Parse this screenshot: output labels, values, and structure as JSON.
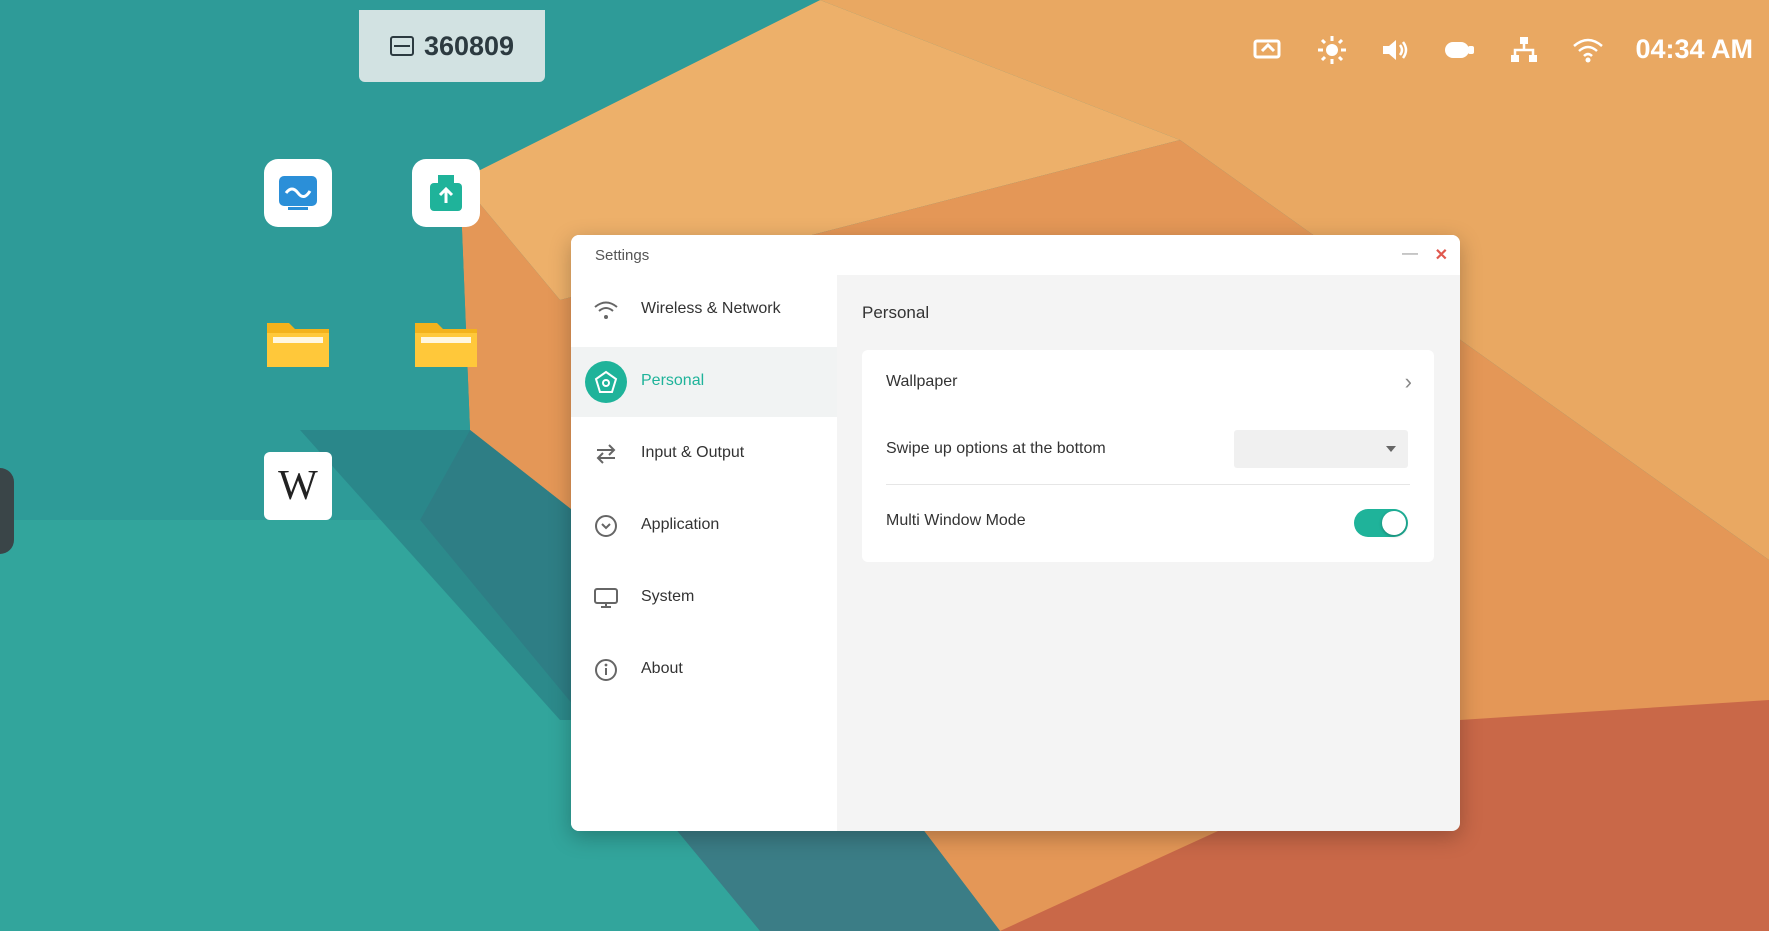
{
  "topbar": {
    "device_id": "360809",
    "device_icon": "monitor-icon",
    "time": "04:34 AM"
  },
  "status_icons": [
    "screen-share-icon",
    "brightness-icon",
    "volume-icon",
    "camera-icon",
    "network-icon",
    "wifi-icon"
  ],
  "desktop": {
    "icons": []
  },
  "window": {
    "title": "Settings",
    "sidebar": [
      {
        "title": "Wireless & Network",
        "subtitle": "",
        "icon": "wifi-icon",
        "active": false
      },
      {
        "title": "Personal",
        "subtitle": "",
        "icon": "personal-icon",
        "active": true
      },
      {
        "title": "Input & Output",
        "subtitle": "",
        "icon": "swap-icon",
        "active": false
      },
      {
        "title": "Application",
        "subtitle": "",
        "icon": "app-icon",
        "active": false
      },
      {
        "title": "System",
        "subtitle": "",
        "icon": "monitor-icon",
        "active": false
      },
      {
        "title": "About",
        "subtitle": "",
        "icon": "info-icon",
        "active": false
      }
    ],
    "content": {
      "title": "Personal",
      "wallpaper_label": "Wallpaper",
      "swipe_label": "Swipe up options at the bottom",
      "swipe_value": "",
      "multiwindow_label": "Multi Window Mode",
      "multiwindow_desc": "",
      "multiwindow_on": true
    }
  },
  "colors": {
    "accent": "#1fb39a",
    "teal_bg": "#2a8f8f",
    "orange_bg": "#e8a35f"
  }
}
